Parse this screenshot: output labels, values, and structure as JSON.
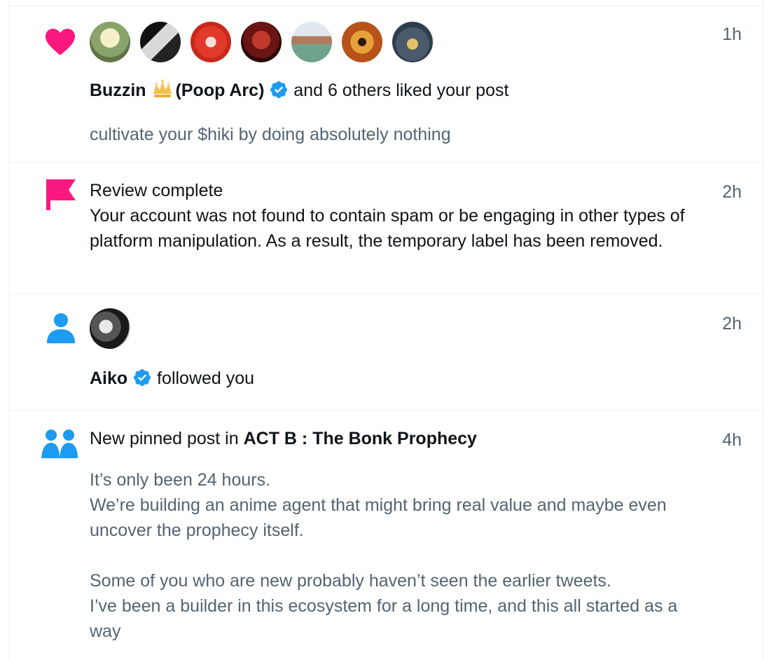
{
  "notifications": [
    {
      "type": "like",
      "icon": "heart-icon",
      "time": "1h",
      "avatars": [
        "avatar-1",
        "avatar-2",
        "avatar-3",
        "avatar-4",
        "avatar-5",
        "avatar-6",
        "avatar-7"
      ],
      "actor_name": "Buzzin",
      "actor_suffix": "(Poop Arc)",
      "action_text": "and 6 others liked your post",
      "post_preview": "cultivate your $hiki by doing absolutely nothing"
    },
    {
      "type": "review",
      "icon": "flag-icon",
      "time": "2h",
      "title": "Review complete",
      "body": "Your account was not found to contain spam or be engaging in other types of platform manipulation. As a result, the temporary label has been removed."
    },
    {
      "type": "follow",
      "icon": "person-icon",
      "time": "2h",
      "actor_name": "Aiko",
      "action_text": "followed you"
    },
    {
      "type": "community",
      "icon": "people-icon",
      "time": "4h",
      "prefix": "New pinned post in",
      "community": "ACT B : The Bonk Prophecy",
      "paragraph_1": "It’s only been 24 hours.\nWe’re building an anime agent that might bring real value and maybe even uncover the prophecy itself.",
      "paragraph_2": "Some of you who are new probably haven’t seen the earlier tweets.\nI’ve been a builder in this ecosystem for a long time, and this all started as a way"
    }
  ],
  "colors": {
    "heart": "#f91880",
    "flag": "#f91880",
    "person": "#1d9bf0",
    "verified": "#1d9bf0",
    "muted": "#536471"
  }
}
